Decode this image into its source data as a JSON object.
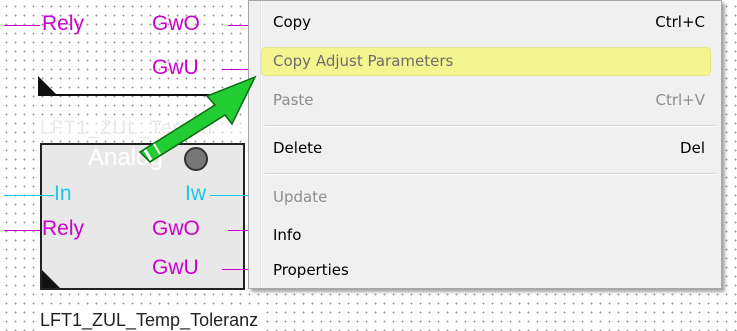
{
  "diagram": {
    "top_block": {
      "pins_left": [
        "Rely"
      ],
      "pins_right": [
        "GwO",
        "GwU"
      ]
    },
    "block2": {
      "title": "LFT1_ZUL_Temp.I",
      "type_label": "Analog",
      "pins_left": [
        "In",
        "Rely"
      ],
      "pins_right": [
        "Iw",
        "GwO",
        "GwU"
      ]
    },
    "bottom_label": "LFT1_ZUL_Temp_Toleranz"
  },
  "context_menu": {
    "items": [
      {
        "label": "Copy",
        "shortcut": "Ctrl+C",
        "enabled": true
      },
      {
        "label": "Copy Adjust Parameters",
        "shortcut": "",
        "enabled": true,
        "highlighted": true
      },
      {
        "label": "Paste",
        "shortcut": "Ctrl+V",
        "enabled": false
      },
      {
        "label": "Delete",
        "shortcut": "Del",
        "enabled": true
      },
      {
        "label": "Update",
        "shortcut": "",
        "enabled": false
      },
      {
        "label": "Info",
        "shortcut": "",
        "enabled": true
      },
      {
        "label": "Properties",
        "shortcut": "",
        "enabled": true
      }
    ]
  },
  "colors": {
    "output_pins": "#cc00cc",
    "input_pins": "#19c8e6",
    "highlight": "#f3f58f",
    "arrow": "#22cc33"
  }
}
